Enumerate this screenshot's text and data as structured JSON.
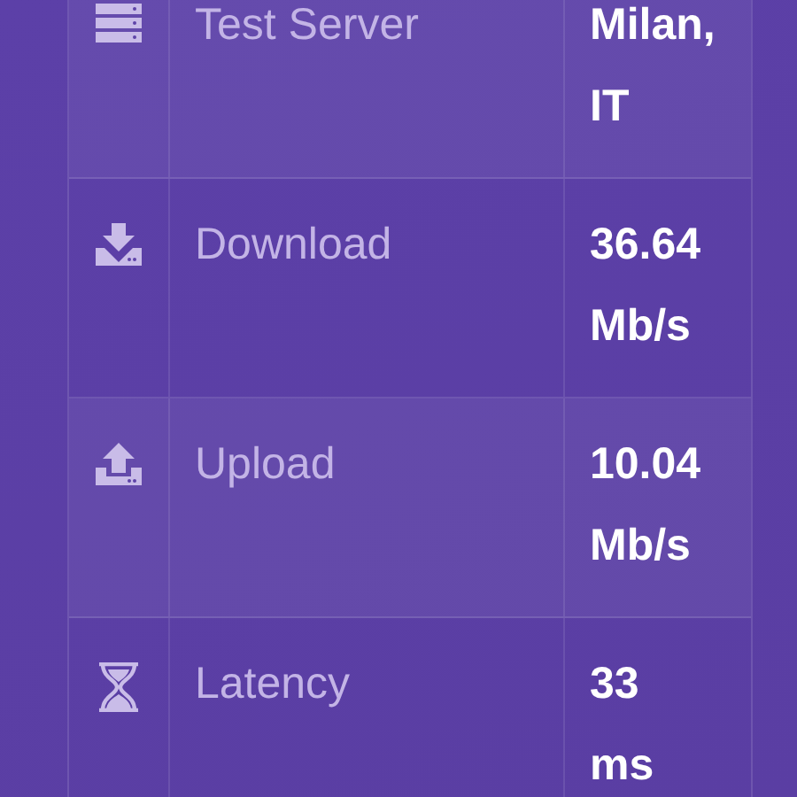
{
  "rows": [
    {
      "kind": "server",
      "label": "Test Server",
      "value": "Milan, IT"
    },
    {
      "kind": "download",
      "label": "Download",
      "value": "36.64 Mb/s"
    },
    {
      "kind": "upload",
      "label": "Upload",
      "value": "10.04 Mb/s"
    },
    {
      "kind": "latency",
      "label": "Latency",
      "value": "33 ms"
    }
  ]
}
